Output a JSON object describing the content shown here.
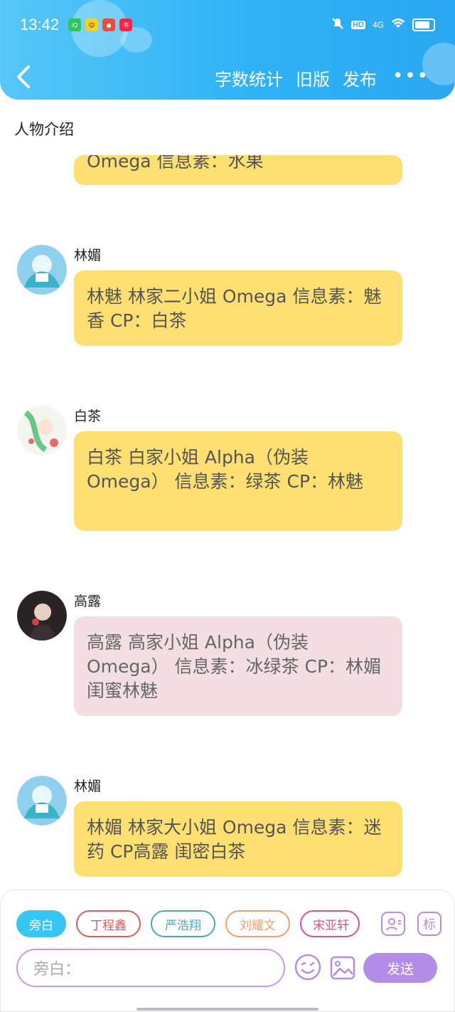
{
  "status_bar": {
    "time": "13:42",
    "app_icons": [
      "iqiyi-icon",
      "app-yellow-icon",
      "weibo-icon",
      "xiaohongshu-icon"
    ],
    "signal_text": "4G",
    "hd_text": "HD"
  },
  "header": {
    "actions": [
      "字数统计",
      "旧版",
      "发布"
    ],
    "more_label": "•••"
  },
  "section_title": "人物介绍",
  "entries": [
    {
      "name": "",
      "text": "Omega 信息素：水果",
      "style": "yellow"
    },
    {
      "name": "林媚",
      "text": "林魅 林家二小姐 Omega 信息素：魅香 CP：白茶",
      "style": "yellow"
    },
    {
      "name": "白茶",
      "text": "白茶 白家小姐 Alpha（伪装 Omega） 信息素：绿茶 CP：林魅",
      "style": "yellow"
    },
    {
      "name": "高露",
      "text": "高露 高家小姐 Alpha（伪装 Omega） 信息素：冰绿茶 CP：林媚 闺蜜林魅",
      "style": "pink"
    },
    {
      "name": "林媚",
      "text": "林媚 林家大小姐 Omega 信息素：迷药 CP高露 闺密白茶",
      "style": "yellow"
    }
  ],
  "chips": [
    {
      "label": "旁白",
      "color": "#36c6f4",
      "active": true
    },
    {
      "label": "丁程鑫",
      "color": "#e05a5a",
      "active": false
    },
    {
      "label": "严浩翔",
      "color": "#4aa9b9",
      "active": false
    },
    {
      "label": "刘耀文",
      "color": "#f0a070",
      "active": false
    },
    {
      "label": "宋亚轩",
      "color": "#e0508a",
      "active": false
    }
  ],
  "tools": {
    "mark_label": "标"
  },
  "input": {
    "placeholder": "旁白："
  },
  "send_label": "发送"
}
